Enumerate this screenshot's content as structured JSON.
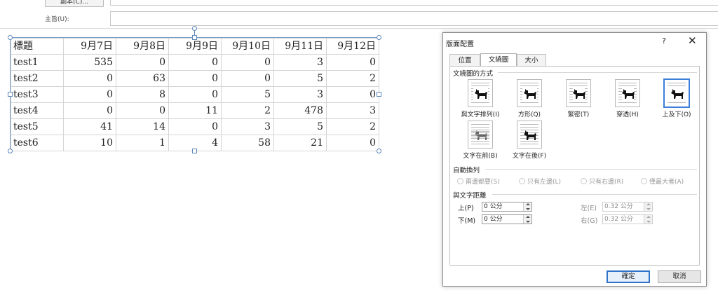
{
  "header": {
    "cc_button_label": "副本(C)...",
    "subject_label": "主旨(U):",
    "subject_value": ""
  },
  "table": {
    "columns": [
      "標題",
      "9月7日",
      "9月8日",
      "9月9日",
      "9月10日",
      "9月11日",
      "9月12日"
    ],
    "rows": [
      [
        "test1",
        "535",
        "0",
        "0",
        "0",
        "3",
        "0"
      ],
      [
        "test2",
        "0",
        "63",
        "0",
        "0",
        "5",
        "2"
      ],
      [
        "test3",
        "0",
        "8",
        "0",
        "5",
        "3",
        "0"
      ],
      [
        "test4",
        "0",
        "0",
        "11",
        "2",
        "478",
        "3"
      ],
      [
        "test5",
        "41",
        "14",
        "0",
        "3",
        "5",
        "2"
      ],
      [
        "test6",
        "10",
        "1",
        "4",
        "58",
        "21",
        "0"
      ]
    ]
  },
  "dialog": {
    "title": "版面配置",
    "help": "?",
    "close": "✕",
    "tabs": [
      {
        "label": "位置",
        "active": false
      },
      {
        "label": "文繞圖",
        "active": true
      },
      {
        "label": "大小",
        "active": false
      }
    ],
    "wrap_section_label": "文繞圖的方式",
    "wrap_options": [
      {
        "label": "與文字排列(I)",
        "icon": "wrap-inline-icon",
        "selected": false
      },
      {
        "label": "方形(Q)",
        "icon": "wrap-square-icon",
        "selected": false
      },
      {
        "label": "緊密(T)",
        "icon": "wrap-tight-icon",
        "selected": false
      },
      {
        "label": "穿透(H)",
        "icon": "wrap-through-icon",
        "selected": false
      },
      {
        "label": "上及下(O)",
        "icon": "wrap-top-bottom-icon",
        "selected": true
      },
      {
        "label": "文字在前(B)",
        "icon": "wrap-behind-text-icon",
        "selected": false
      },
      {
        "label": "文字在後(F)",
        "icon": "wrap-in-front-icon",
        "selected": false
      }
    ],
    "autowrap_section_label": "自動換列",
    "autowrap_options": [
      "兩邊都要(S)",
      "只有左邊(L)",
      "只有右邊(R)",
      "僅最大者(A)"
    ],
    "distance_section_label": "與文字距離",
    "distance": {
      "top_label": "上(P)",
      "top_value": "0 公分",
      "bottom_label": "下(M)",
      "bottom_value": "0 公分",
      "left_label": "左(E)",
      "left_value": "0.32 公分",
      "right_label": "右(G)",
      "right_value": "0.32 公分"
    },
    "ok_label": "確定",
    "cancel_label": "取消"
  }
}
